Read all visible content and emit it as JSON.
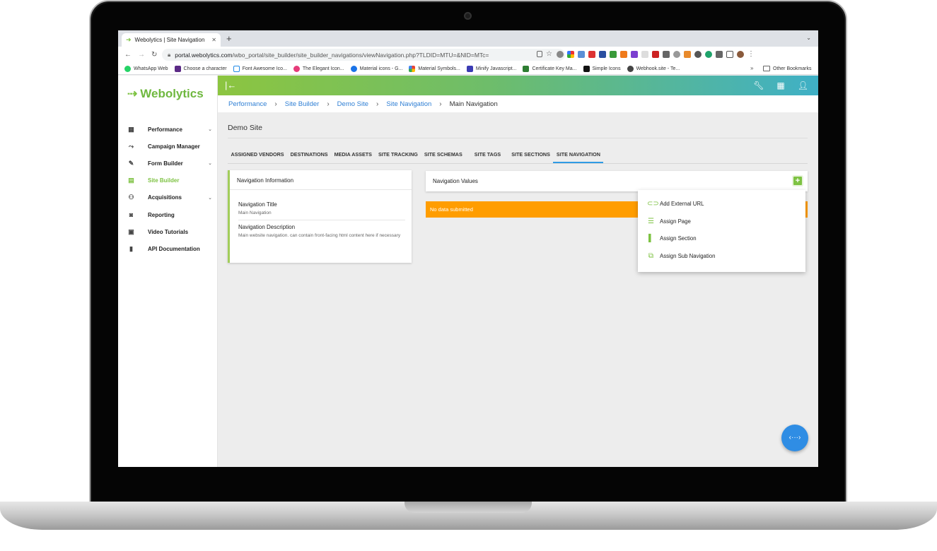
{
  "browser": {
    "tab_title": "Webolytics | Site Navigation",
    "url_domain": "portal.webolytics.com",
    "url_path": "/wbo_portal/site_builder/site_builder_navigations/viewNavigation.php?TLDID=MTU=&NID=MTc=",
    "bookmarks": [
      {
        "label": "WhatsApp Web",
        "color": "#25d366"
      },
      {
        "label": "Choose a character",
        "color": "#5b2a86"
      },
      {
        "label": "Font Awesome Ico...",
        "color": "#228ae6"
      },
      {
        "label": "The Elegant Icon...",
        "color": "#e63b7a"
      },
      {
        "label": "Material icons - G...",
        "color": "#1a73e8"
      },
      {
        "label": "Material Symbols...",
        "color": "#f9ab00"
      },
      {
        "label": "Minify Javascript...",
        "color": "#3b3bb3"
      },
      {
        "label": "Certificate Key Ma...",
        "color": "#2e7d32"
      },
      {
        "label": "Simple Icons",
        "color": "#111111"
      },
      {
        "label": "Webhook.site - Te...",
        "color": "#444444"
      }
    ],
    "bookmarks_more": "»",
    "other_bookmarks": "Other Bookmarks"
  },
  "app": {
    "logo_text": "Webolytics",
    "accent_color": "#7dc242",
    "sidebar": [
      {
        "label": "Performance",
        "icon": "dashboard-icon",
        "expandable": true,
        "active": false
      },
      {
        "label": "Campaign Manager",
        "icon": "trend-icon",
        "expandable": false,
        "active": false
      },
      {
        "label": "Form Builder",
        "icon": "form-icon",
        "expandable": true,
        "active": false
      },
      {
        "label": "Site Builder",
        "icon": "web-icon",
        "expandable": false,
        "active": true
      },
      {
        "label": "Acquisitions",
        "icon": "people-icon",
        "expandable": true,
        "active": false
      },
      {
        "label": "Reporting",
        "icon": "report-icon",
        "expandable": false,
        "active": false
      },
      {
        "label": "Video Tutorials",
        "icon": "video-icon",
        "expandable": false,
        "active": false
      },
      {
        "label": "API Documentation",
        "icon": "book-icon",
        "expandable": false,
        "active": false
      }
    ],
    "breadcrumb": [
      "Performance",
      "Site Builder",
      "Demo Site",
      "Site Navigation",
      "Main Navigation"
    ],
    "page_title": "Demo Site",
    "tabs": [
      "ASSIGNED VENDORS",
      "DESTINATIONS",
      "MEDIA ASSETS",
      "SITE TRACKING",
      "SITE SCHEMAS",
      "SITE TAGS",
      "SITE SECTIONS",
      "SITE NAVIGATION"
    ],
    "active_tab": "SITE NAVIGATION",
    "info_card": {
      "title": "Navigation Information",
      "nav_title_label": "Navigation Title",
      "nav_title_value": "Main Navigation",
      "nav_desc_label": "Navigation Description",
      "nav_desc_value": "Main website navigation.  can contain front-facing html content here if necessary"
    },
    "values_card": {
      "title": "Navigation Values",
      "add_symbol": "+"
    },
    "alert": "No data submitted",
    "dropdown": [
      {
        "label": "Add External URL",
        "icon": "link-icon"
      },
      {
        "label": "Assign Page",
        "icon": "page-icon"
      },
      {
        "label": "Assign Section",
        "icon": "section-icon"
      },
      {
        "label": "Assign Sub Navigation",
        "icon": "open-in-new-icon"
      }
    ],
    "fab_symbol": "‹···›"
  }
}
